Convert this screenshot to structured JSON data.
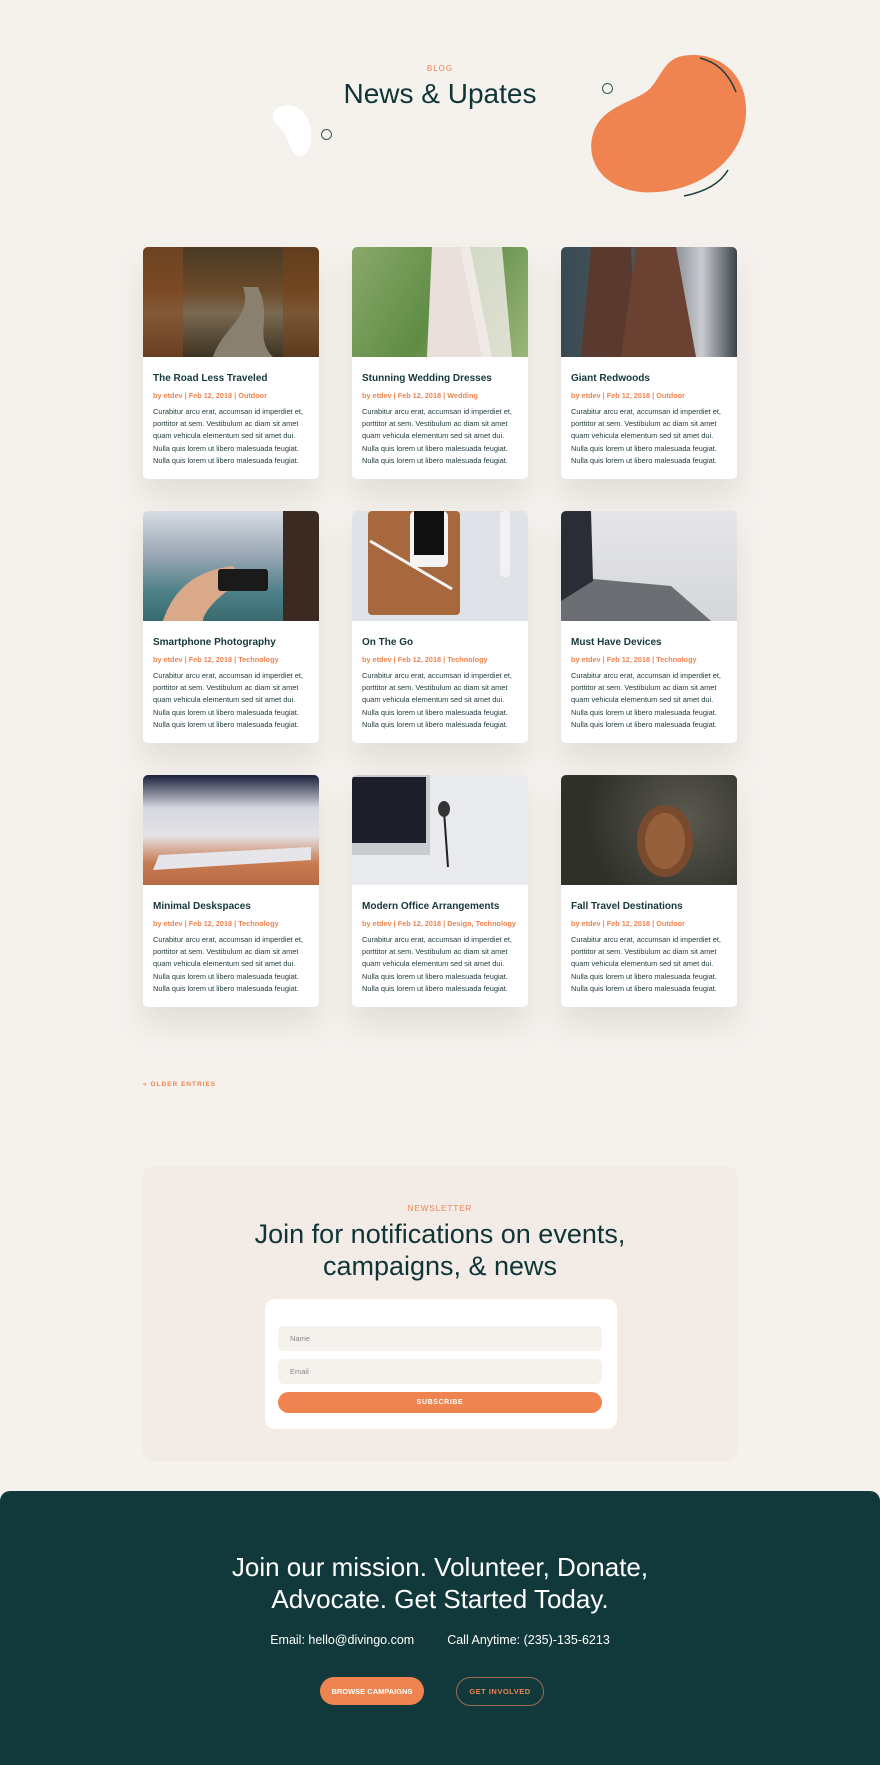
{
  "hero": {
    "eyebrow": "BLOG",
    "title": "News & Upates"
  },
  "posts": [
    {
      "title": "The Road Less Traveled",
      "meta": "by etdev | Feb 12, 2018 | Outdoor",
      "image": "forest-road-photo"
    },
    {
      "title": "Stunning Wedding Dresses",
      "meta": "by etdev | Feb 12, 2018 | Wedding",
      "image": "wedding-dress-photo"
    },
    {
      "title": "Giant Redwoods",
      "meta": "by etdev | Feb 12, 2018 | Outdoor",
      "image": "redwoods-photo"
    },
    {
      "title": "Smartphone Photography",
      "meta": "by etdev | Feb 12, 2018 | Technology",
      "image": "smartphone-photo"
    },
    {
      "title": "On The Go",
      "meta": "by etdev | Feb 12, 2018 | Technology",
      "image": "tablet-phone-photo"
    },
    {
      "title": "Must Have Devices",
      "meta": "by etdev | Feb 12, 2018 | Technology",
      "image": "laptop-photo"
    },
    {
      "title": "Minimal Deskspaces",
      "meta": "by etdev | Feb 12, 2018 | Technology",
      "image": "keyboard-photo"
    },
    {
      "title": "Modern Office Arrangements",
      "meta": "by etdev | Feb 12, 2018 | Design, Technology",
      "image": "office-desk-photo"
    },
    {
      "title": "Fall Travel Destinations",
      "meta": "by etdev | Feb 12, 2018 | Outdoor",
      "image": "pinecone-photo"
    }
  ],
  "excerpt": "Curabitur arcu erat, accumsan id imperdiet et, porttitor at sem. Vestibulum ac diam sit amet quam vehicula elementum sed sit amet dui. Nulla quis lorem ut libero malesuada feugiat. Nulla quis lorem ut libero malesuada feugiat.",
  "pagination": {
    "older_label": "« OLDER ENTRIES"
  },
  "newsletter": {
    "eyebrow": "NEWSLETTER",
    "title": "Join for notifications on events, campaigns, & news",
    "name_placeholder": "Name",
    "email_placeholder": "Email",
    "subscribe_label": "SUBSCRIBE"
  },
  "footer": {
    "title": "Join our mission. Volunteer, Donate, Advocate. Get Started Today.",
    "email": "Email: hello@divingo.com",
    "phone": "Call Anytime: (235)-135-6213",
    "browse_label": "BROWSE CAMPAIGNS",
    "involved_label": "GET INVOLVED"
  },
  "colors": {
    "accent": "#ef8450",
    "dark": "#11393b",
    "background": "#f5f2ee"
  }
}
